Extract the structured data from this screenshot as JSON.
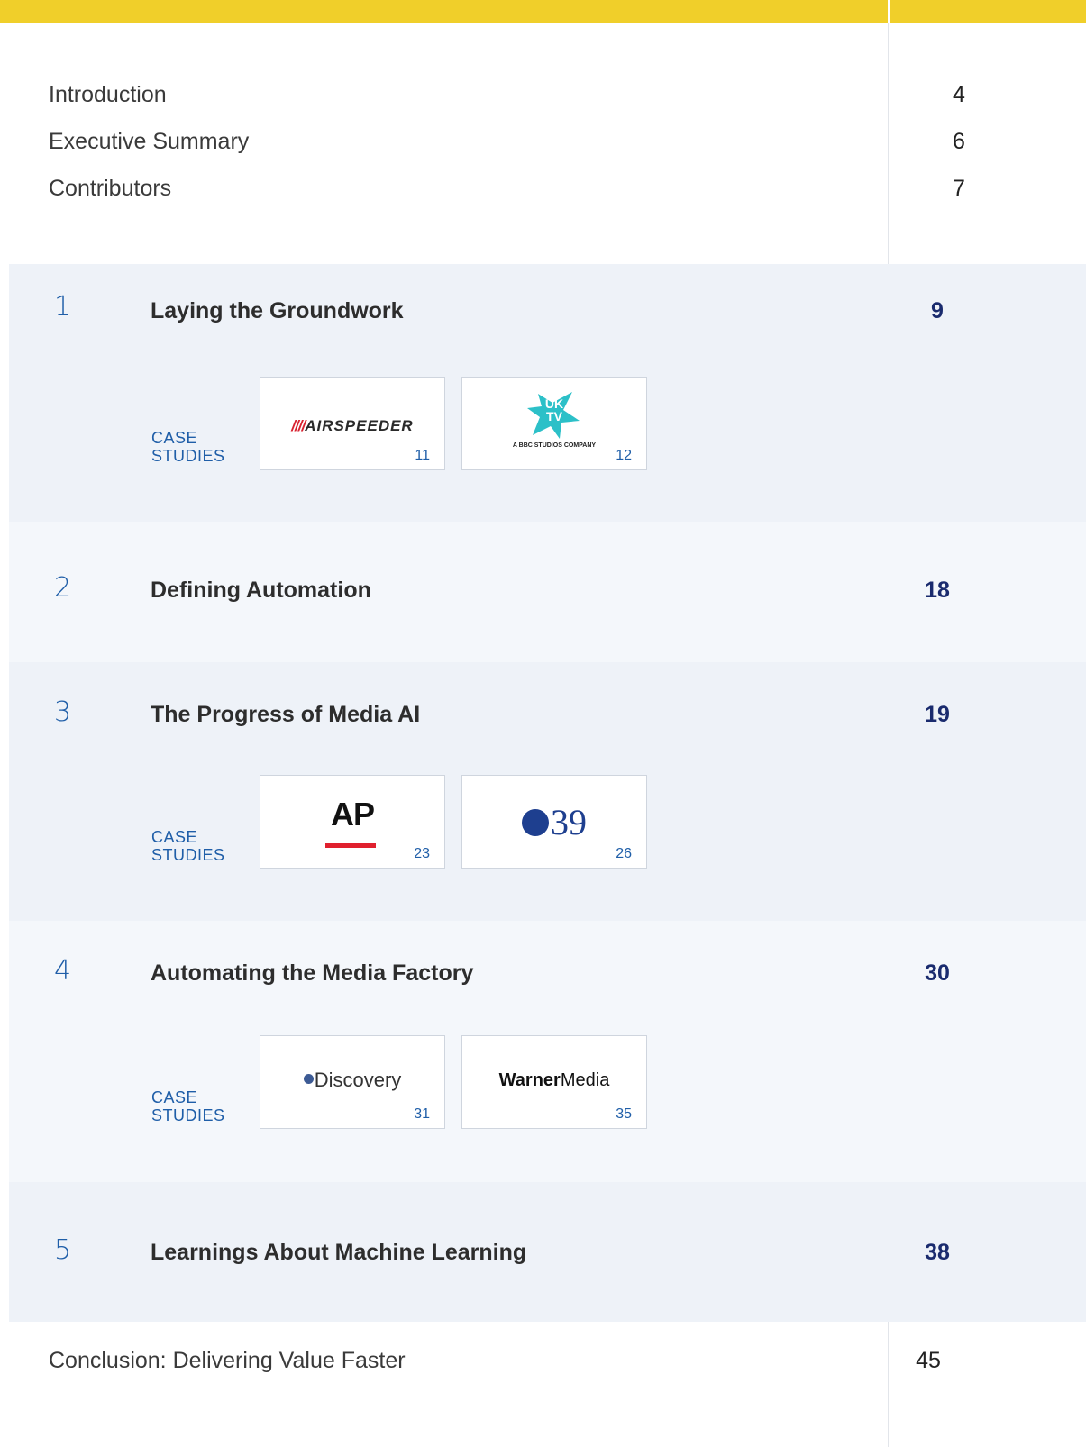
{
  "front_matter": [
    {
      "label": "Introduction",
      "page": "4"
    },
    {
      "label": "Executive Summary",
      "page": "6"
    },
    {
      "label": "Contributors",
      "page": "7"
    }
  ],
  "case_studies_label_line1": "CASE",
  "case_studies_label_line2": "STUDIES",
  "sections": [
    {
      "number": "1",
      "title": "Laying the Groundwork",
      "page": "9",
      "cases": [
        {
          "logo": "AIRSPEEDER",
          "logo_slashes": "////",
          "page": "11"
        },
        {
          "logo": "UK TV",
          "logo_sub": "A BBC STUDIOS COMPANY",
          "page": "12"
        }
      ]
    },
    {
      "number": "2",
      "title": "Defining Automation",
      "page": "18",
      "cases": []
    },
    {
      "number": "3",
      "title": "The Progress of Media AI",
      "page": "19",
      "cases": [
        {
          "logo": "AP",
          "page": "23"
        },
        {
          "logo": "39",
          "page": "26"
        }
      ]
    },
    {
      "number": "4",
      "title": "Automating the Media Factory",
      "page": "30",
      "cases": [
        {
          "logo": "Discovery",
          "page": "31"
        },
        {
          "logo_bold": "Warner",
          "logo": "Media",
          "page": "35"
        }
      ]
    },
    {
      "number": "5",
      "title": "Learnings About Machine Learning",
      "page": "38",
      "cases": []
    }
  ],
  "conclusion": {
    "label": "Conclusion: Delivering Value Faster",
    "page": "45"
  },
  "colors": {
    "accent_yellow": "#f0cf2a",
    "accent_blue": "#1f5ea8",
    "page_navy": "#1a2b6e"
  }
}
